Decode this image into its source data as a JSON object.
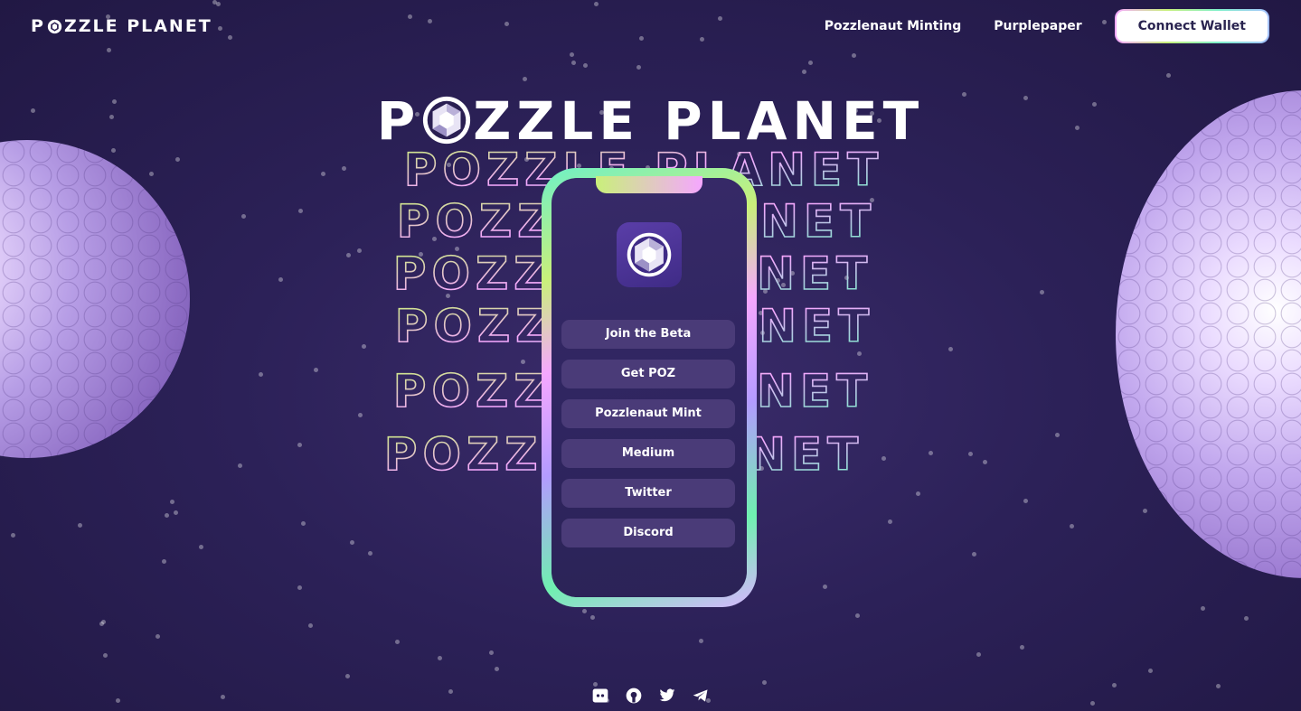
{
  "header": {
    "logo_text": "PZZLE PLANET",
    "logo_prefix": "P",
    "logo_suffix": "ZZLE PLANET",
    "nav": [
      {
        "label": "Pozzlenaut Minting"
      },
      {
        "label": "Purplepaper"
      }
    ],
    "connect_label": "Connect Wallet"
  },
  "hero": {
    "title_prefix": "P",
    "title_suffix": "ZZLE PLANET",
    "echo_text": "POZZLE PLANET"
  },
  "phone": {
    "app_icon": "pozzle-gem-icon",
    "links": [
      {
        "label": "Join the Beta"
      },
      {
        "label": "Get POZ"
      },
      {
        "label": "Pozzlenaut Mint"
      },
      {
        "label": "Medium"
      },
      {
        "label": "Twitter"
      },
      {
        "label": "Discord"
      }
    ]
  },
  "footer": {
    "icons": [
      "discord-icon",
      "github-icon",
      "twitter-icon",
      "telegram-icon"
    ]
  },
  "colors": {
    "background": "#2a1f52",
    "accent_green": "#6ff0c6",
    "accent_yellow": "#c9f07a",
    "accent_pink": "#f5a7ff",
    "planet": "#b79ee6"
  }
}
